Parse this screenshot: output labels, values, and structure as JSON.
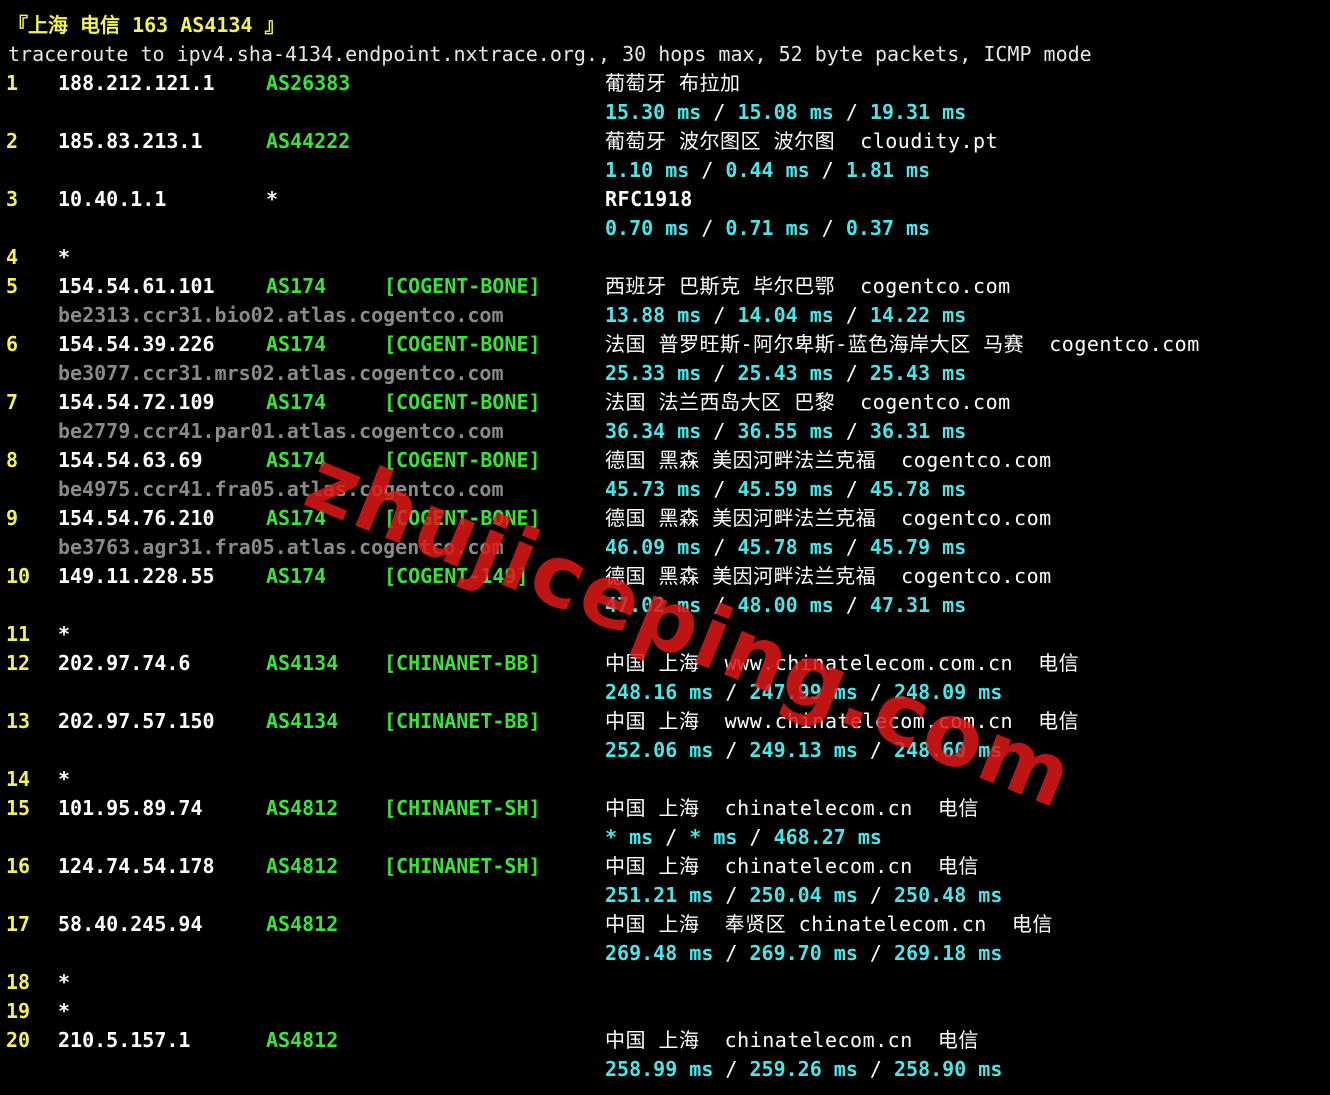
{
  "header": {
    "title": "『上海 电信 163 AS4134 』",
    "command": "traceroute to ipv4.sha-4134.endpoint.nxtrace.org., 30 hops max, 52 byte packets, ICMP mode"
  },
  "watermark": "zhujiceping.com",
  "hops": [
    {
      "num": "1",
      "ip": "188.212.121.1",
      "asn": "AS26383",
      "tag": "",
      "geo": "葡萄牙 布拉加",
      "rdns": "",
      "rtt": [
        "15.30 ms",
        "15.08 ms",
        "19.31 ms"
      ]
    },
    {
      "num": "2",
      "ip": "185.83.213.1",
      "asn": "AS44222",
      "tag": "",
      "geo": "葡萄牙 波尔图区 波尔图  cloudity.pt",
      "rdns": "",
      "rtt": [
        "1.10 ms",
        "0.44 ms",
        "1.81 ms"
      ]
    },
    {
      "num": "3",
      "ip": "10.40.1.1",
      "asn": "*",
      "tag": "",
      "geo": "RFC1918",
      "rdns": "",
      "rtt": [
        "0.70 ms",
        "0.71 ms",
        "0.37 ms"
      ]
    },
    {
      "num": "4",
      "ip": "*",
      "asn": "",
      "tag": "",
      "geo": "",
      "rdns": "",
      "rtt": []
    },
    {
      "num": "5",
      "ip": "154.54.61.101",
      "asn": "AS174",
      "tag": "[COGENT-BONE]",
      "geo": "西班牙 巴斯克 毕尔巴鄂  cogentco.com",
      "rdns": "be2313.ccr31.bio02.atlas.cogentco.com",
      "rtt": [
        "13.88 ms",
        "14.04 ms",
        "14.22 ms"
      ]
    },
    {
      "num": "6",
      "ip": "154.54.39.226",
      "asn": "AS174",
      "tag": "[COGENT-BONE]",
      "geo": "法国 普罗旺斯-阿尔卑斯-蓝色海岸大区 马赛  cogentco.com",
      "rdns": "be3077.ccr31.mrs02.atlas.cogentco.com",
      "rtt": [
        "25.33 ms",
        "25.43 ms",
        "25.43 ms"
      ]
    },
    {
      "num": "7",
      "ip": "154.54.72.109",
      "asn": "AS174",
      "tag": "[COGENT-BONE]",
      "geo": "法国 法兰西岛大区 巴黎  cogentco.com",
      "rdns": "be2779.ccr41.par01.atlas.cogentco.com",
      "rtt": [
        "36.34 ms",
        "36.55 ms",
        "36.31 ms"
      ]
    },
    {
      "num": "8",
      "ip": "154.54.63.69",
      "asn": "AS174",
      "tag": "[COGENT-BONE]",
      "geo": "德国 黑森 美因河畔法兰克福  cogentco.com",
      "rdns": "be4975.ccr41.fra05.atlas.cogentco.com",
      "rtt": [
        "45.73 ms",
        "45.59 ms",
        "45.78 ms"
      ]
    },
    {
      "num": "9",
      "ip": "154.54.76.210",
      "asn": "AS174",
      "tag": "[COGENT-BONE]",
      "geo": "德国 黑森 美因河畔法兰克福  cogentco.com",
      "rdns": "be3763.agr31.fra05.atlas.cogentco.com",
      "rtt": [
        "46.09 ms",
        "45.78 ms",
        "45.79 ms"
      ]
    },
    {
      "num": "10",
      "ip": "149.11.228.55",
      "asn": "AS174",
      "tag": "[COGENT-149]",
      "geo": "德国 黑森 美因河畔法兰克福  cogentco.com",
      "rdns": "",
      "rtt": [
        "47.02 ms",
        "48.00 ms",
        "47.31 ms"
      ]
    },
    {
      "num": "11",
      "ip": "*",
      "asn": "",
      "tag": "",
      "geo": "",
      "rdns": "",
      "rtt": []
    },
    {
      "num": "12",
      "ip": "202.97.74.6",
      "asn": "AS4134",
      "tag": "[CHINANET-BB]",
      "geo": "中国 上海  www.chinatelecom.com.cn  电信",
      "rdns": "",
      "rtt": [
        "248.16 ms",
        "247.99 ms",
        "248.09 ms"
      ]
    },
    {
      "num": "13",
      "ip": "202.97.57.150",
      "asn": "AS4134",
      "tag": "[CHINANET-BB]",
      "geo": "中国 上海  www.chinatelecom.com.cn  电信",
      "rdns": "",
      "rtt": [
        "252.06 ms",
        "249.13 ms",
        "248.60 ms"
      ]
    },
    {
      "num": "14",
      "ip": "*",
      "asn": "",
      "tag": "",
      "geo": "",
      "rdns": "",
      "rtt": []
    },
    {
      "num": "15",
      "ip": "101.95.89.74",
      "asn": "AS4812",
      "tag": "[CHINANET-SH]",
      "geo": "中国 上海  chinatelecom.cn  电信",
      "rdns": "",
      "rtt": [
        "* ms",
        "* ms",
        "468.27 ms"
      ]
    },
    {
      "num": "16",
      "ip": "124.74.54.178",
      "asn": "AS4812",
      "tag": "[CHINANET-SH]",
      "geo": "中国 上海  chinatelecom.cn  电信",
      "rdns": "",
      "rtt": [
        "251.21 ms",
        "250.04 ms",
        "250.48 ms"
      ]
    },
    {
      "num": "17",
      "ip": "58.40.245.94",
      "asn": "AS4812",
      "tag": "",
      "geo": "中国 上海  奉贤区 chinatelecom.cn  电信",
      "rdns": "",
      "rtt": [
        "269.48 ms",
        "269.70 ms",
        "269.18 ms"
      ]
    },
    {
      "num": "18",
      "ip": "*",
      "asn": "",
      "tag": "",
      "geo": "",
      "rdns": "",
      "rtt": []
    },
    {
      "num": "19",
      "ip": "*",
      "asn": "",
      "tag": "",
      "geo": "",
      "rdns": "",
      "rtt": []
    },
    {
      "num": "20",
      "ip": "210.5.157.1",
      "asn": "AS4812",
      "tag": "",
      "geo": "中国 上海  chinatelecom.cn  电信",
      "rdns": "",
      "rtt": [
        "258.99 ms",
        "259.26 ms",
        "258.90 ms"
      ]
    }
  ]
}
